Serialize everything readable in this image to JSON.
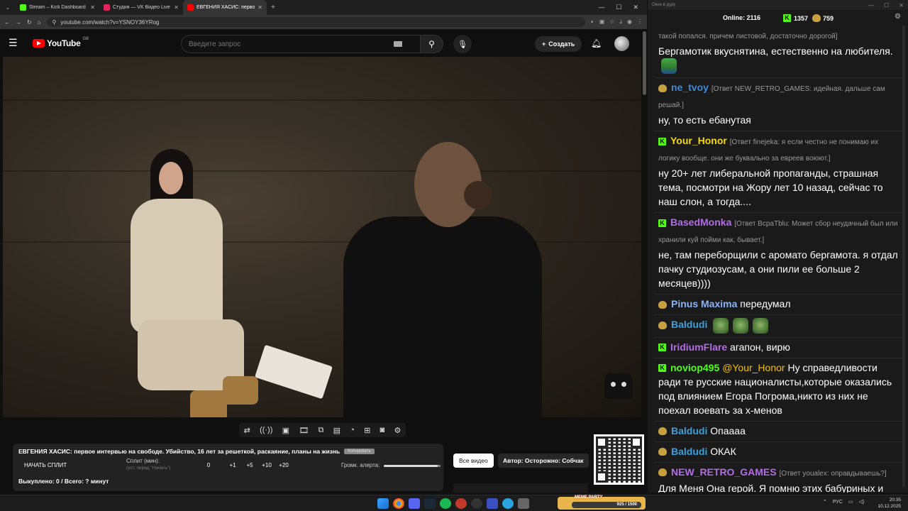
{
  "browser": {
    "tabs": [
      {
        "title": "Stream – Kick Dashboard",
        "color": "#53fc18",
        "active": false
      },
      {
        "title": "Студия — VK Видео Live",
        "color": "#e0245e",
        "active": false
      },
      {
        "title": "ЕВГЕНИЯ ХАСИС: первое ·",
        "color": "#ff0000",
        "active": true
      }
    ],
    "url": "youtube.com/watch?v=YSNOY36YRog"
  },
  "youtube": {
    "logo_text": "YouTube",
    "logo_region": "GB",
    "search_placeholder": "Введите запрос",
    "create_label": "Создать"
  },
  "panel": {
    "title": "ЕВГЕНИЯ ХАСИС: первое интервью на свободе. Убийство, 16 лет за решеткой, раскаяние, планы на жизнь",
    "badge": "Копировать",
    "split_button": "НАЧАТЬ СПЛИТ",
    "split_label": "Сплит (мин):",
    "split_sub": "(уст. перед \"Начать\")",
    "split_values": [
      "0",
      "+1",
      "+5",
      "+10",
      "+20"
    ],
    "alert_label": "Громк. алерта:",
    "alert_level": 0.95,
    "sold_line": "Выкуплено: 0 / Всего: ? минут"
  },
  "buttons": {
    "all_videos": "Все видео",
    "author": "Автор: Осторожно: Собчак"
  },
  "chat": {
    "window_title": "Окно в дуру",
    "online_label": "Online:",
    "online_value": "2116",
    "kick_count": "1357",
    "other_count": "759",
    "colors": {
      "kick": "#53fc18",
      "twitch_badge": "#c8a040"
    },
    "messages": [
      {
        "platform": "none",
        "nick": "",
        "nick_color": "#ffffff",
        "reply": "такой попался. причем листовой, достаточно дорогой]",
        "text": "Бергамотик вкуснятина, естественно на любителя.",
        "emotes": 1
      },
      {
        "platform": "tw",
        "nick": "ne_tvoy",
        "nick_color": "#3a8bdc",
        "reply": "[Ответ NEW_RETRO_GAMES: идейная. дальше сам решай.]",
        "text": "ну, то есть ебанутая",
        "emotes": 0
      },
      {
        "platform": "kick",
        "nick": "Your_Honor",
        "nick_color": "#f5d90a",
        "reply": "[Ответ finejeka: я если честно не понимаю их логику вообще. они же буквально за евреев воюют.]",
        "text": "ну 20+ лет либеральной пропаганды, страшная тема, посмотри на Жору лет 10 назад, сейчас то наш слон, а тогда....",
        "emotes": 0
      },
      {
        "platform": "kick",
        "nick": "BasedMonka",
        "nick_color": "#b46be8",
        "reply": "[Ответ BcpaTblu: Может сбор неудачный был или хранили куй пойми как, бывает.]",
        "text": "не, там переборщили с аромато бергамота. я отдал пачку студиозусам, а они пили ее больше 2 месяцев))))",
        "emotes": 0
      },
      {
        "platform": "tw",
        "nick": "Pinus Maxima",
        "nick_color": "#8ab4f8",
        "reply": "",
        "text": "передумал",
        "emotes": 0
      },
      {
        "platform": "tw",
        "nick": "Baldudi",
        "nick_color": "#3a9fdc",
        "reply": "",
        "text": "",
        "emotes": 3
      },
      {
        "platform": "kick",
        "nick": "IridiumFlare",
        "nick_color": "#b46be8",
        "reply": "",
        "text": "агапон, вирю",
        "emotes": 0
      },
      {
        "platform": "kick",
        "nick": "noviop495",
        "nick_color": "#53fc18",
        "reply": "",
        "mention": "@Your_Honor",
        "text": "Ну справедливости ради те русские националисты,которые оказались под влиянием Егора Погрома,никто из них не поехал воевать за х-менов",
        "emotes": 0
      },
      {
        "platform": "tw",
        "nick": "Baldudi",
        "nick_color": "#3a9fdc",
        "reply": "",
        "text": "Опаааа",
        "emotes": 0
      },
      {
        "platform": "tw",
        "nick": "Baldudi",
        "nick_color": "#3a9fdc",
        "reply": "",
        "text": "ОКАК",
        "emotes": 0
      },
      {
        "platform": "tw",
        "nick": "NEW_RETRO_GAMES",
        "nick_color": "#b46be8",
        "reply": "[Ответ youalex: оправдываешь?]",
        "text": "Для Меня Она герой. Я помню этих бабуриных и ко. Хасис тупо сделала то на что у огромной массы людей в стране не хватило духа.",
        "emotes": 0
      }
    ]
  },
  "taskbar": {
    "meme_title": "MEME PARTY",
    "meme_progress": "925 / 1500",
    "lang": "РУС",
    "time": "20:35",
    "date": "10.12.2025"
  }
}
